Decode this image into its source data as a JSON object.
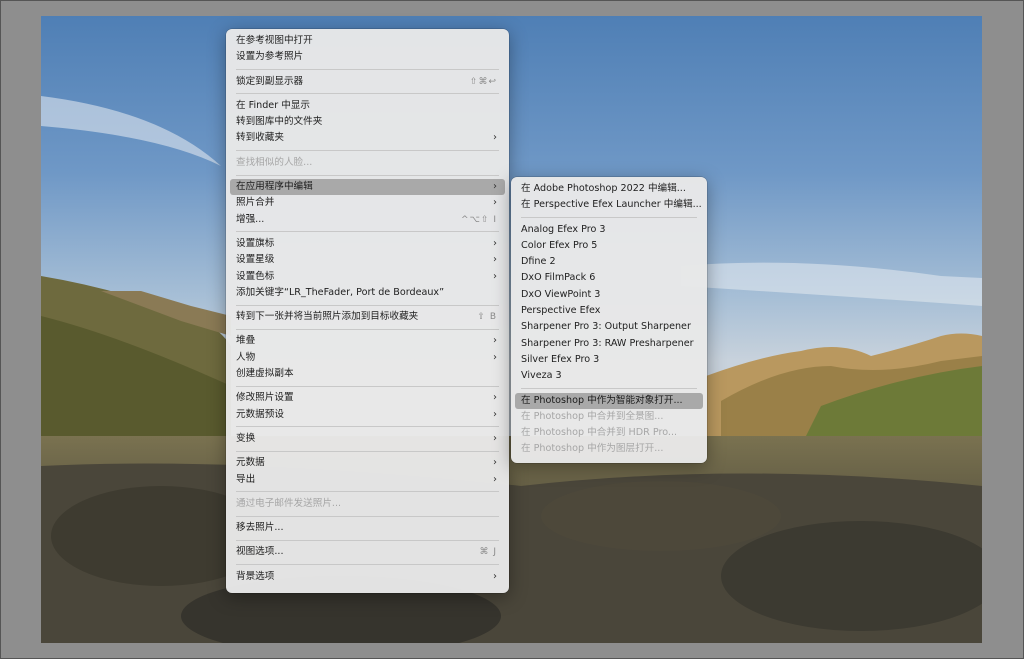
{
  "main_menu": {
    "groups": [
      [
        {
          "label": "在参考视图中打开"
        },
        {
          "label": "设置为参考照片"
        }
      ],
      [
        {
          "label": "锁定到副显示器",
          "shortcut": "⇧⌘↩"
        }
      ],
      [
        {
          "label": "在 Finder 中显示"
        },
        {
          "label": "转到图库中的文件夹"
        },
        {
          "label": "转到收藏夹",
          "submenu": true
        }
      ],
      [
        {
          "label": "查找相似的人脸...",
          "disabled": true
        }
      ],
      [
        {
          "label": "在应用程序中编辑",
          "submenu": true,
          "highlight": true
        },
        {
          "label": "照片合并",
          "submenu": true
        },
        {
          "label": "增强...",
          "shortcut": "^⌥⇧ I"
        }
      ],
      [
        {
          "label": "设置旗标",
          "submenu": true
        },
        {
          "label": "设置星级",
          "submenu": true
        },
        {
          "label": "设置色标",
          "submenu": true
        },
        {
          "label": "添加关键字“LR_TheFader, Port de Bordeaux”"
        }
      ],
      [
        {
          "label": "转到下一张并将当前照片添加到目标收藏夹",
          "shortcut": "⇧ B"
        }
      ],
      [
        {
          "label": "堆叠",
          "submenu": true
        },
        {
          "label": "人物",
          "submenu": true
        },
        {
          "label": "创建虚拟副本"
        }
      ],
      [
        {
          "label": "修改照片设置",
          "submenu": true
        },
        {
          "label": "元数据预设",
          "submenu": true
        }
      ],
      [
        {
          "label": "变换",
          "submenu": true
        }
      ],
      [
        {
          "label": "元数据",
          "submenu": true
        },
        {
          "label": "导出",
          "submenu": true
        }
      ],
      [
        {
          "label": "通过电子邮件发送照片...",
          "disabled": true
        }
      ],
      [
        {
          "label": "移去照片..."
        }
      ],
      [
        {
          "label": "视图选项...",
          "shortcut": "⌘ J"
        }
      ],
      [
        {
          "label": "背景选项",
          "submenu": true
        }
      ]
    ]
  },
  "sub_menu": {
    "groups": [
      [
        {
          "label": "在 Adobe Photoshop 2022 中编辑..."
        },
        {
          "label": "在 Perspective Efex Launcher 中编辑..."
        }
      ],
      [
        {
          "label": "Analog Efex Pro 3"
        },
        {
          "label": "Color Efex Pro 5"
        },
        {
          "label": "Dfine 2"
        },
        {
          "label": "DxO FilmPack 6"
        },
        {
          "label": "DxO ViewPoint 3"
        },
        {
          "label": "Perspective Efex"
        },
        {
          "label": "Sharpener Pro 3: Output Sharpener"
        },
        {
          "label": "Sharpener Pro 3: RAW Presharpener"
        },
        {
          "label": "Silver Efex Pro 3"
        },
        {
          "label": "Viveza 3"
        }
      ],
      [
        {
          "label": "在 Photoshop 中作为智能对象打开...",
          "highlight": true
        },
        {
          "label": "在 Photoshop 中合并到全景图...",
          "disabled": true
        },
        {
          "label": "在 Photoshop 中合并到 HDR Pro...",
          "disabled": true
        },
        {
          "label": "在 Photoshop 中作为图层打开...",
          "disabled": true
        }
      ]
    ]
  },
  "icons": {
    "submenu_arrow": "chevron-right-icon"
  },
  "colors": {
    "menu_bg": "#e8e8e8",
    "highlight": "#a9a9a9",
    "disabled_text": "#a6a6a6"
  }
}
